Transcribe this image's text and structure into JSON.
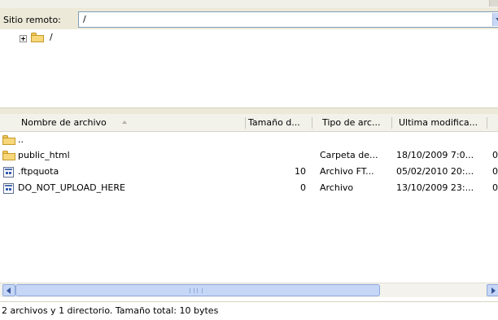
{
  "remote_site": {
    "label": "Sitio remoto:",
    "path": "/"
  },
  "tree": {
    "root_label": "/"
  },
  "file_list": {
    "columns": [
      "Nombre de archivo",
      "Tamaño d...",
      "Tipo de arc...",
      "Ultima modifica..."
    ],
    "rows": [
      {
        "name": "..",
        "size": "",
        "type": "",
        "modified": "",
        "extra": "",
        "icon": "folder-icon"
      },
      {
        "name": "public_html",
        "size": "",
        "type": "Carpeta de...",
        "modified": "18/10/2009 7:0...",
        "extra": "0",
        "icon": "folder-icon"
      },
      {
        "name": ".ftpquota",
        "size": "10",
        "type": "Archivo FT...",
        "modified": "05/02/2010 20:...",
        "extra": "0",
        "icon": "file-icon"
      },
      {
        "name": "DO_NOT_UPLOAD_HERE",
        "size": "0",
        "type": "Archivo",
        "modified": "13/10/2009 23:...",
        "extra": "0",
        "icon": "file-icon"
      }
    ]
  },
  "status": {
    "text": "2 archivos y 1 directorio. Tamaño total: 10 bytes"
  }
}
